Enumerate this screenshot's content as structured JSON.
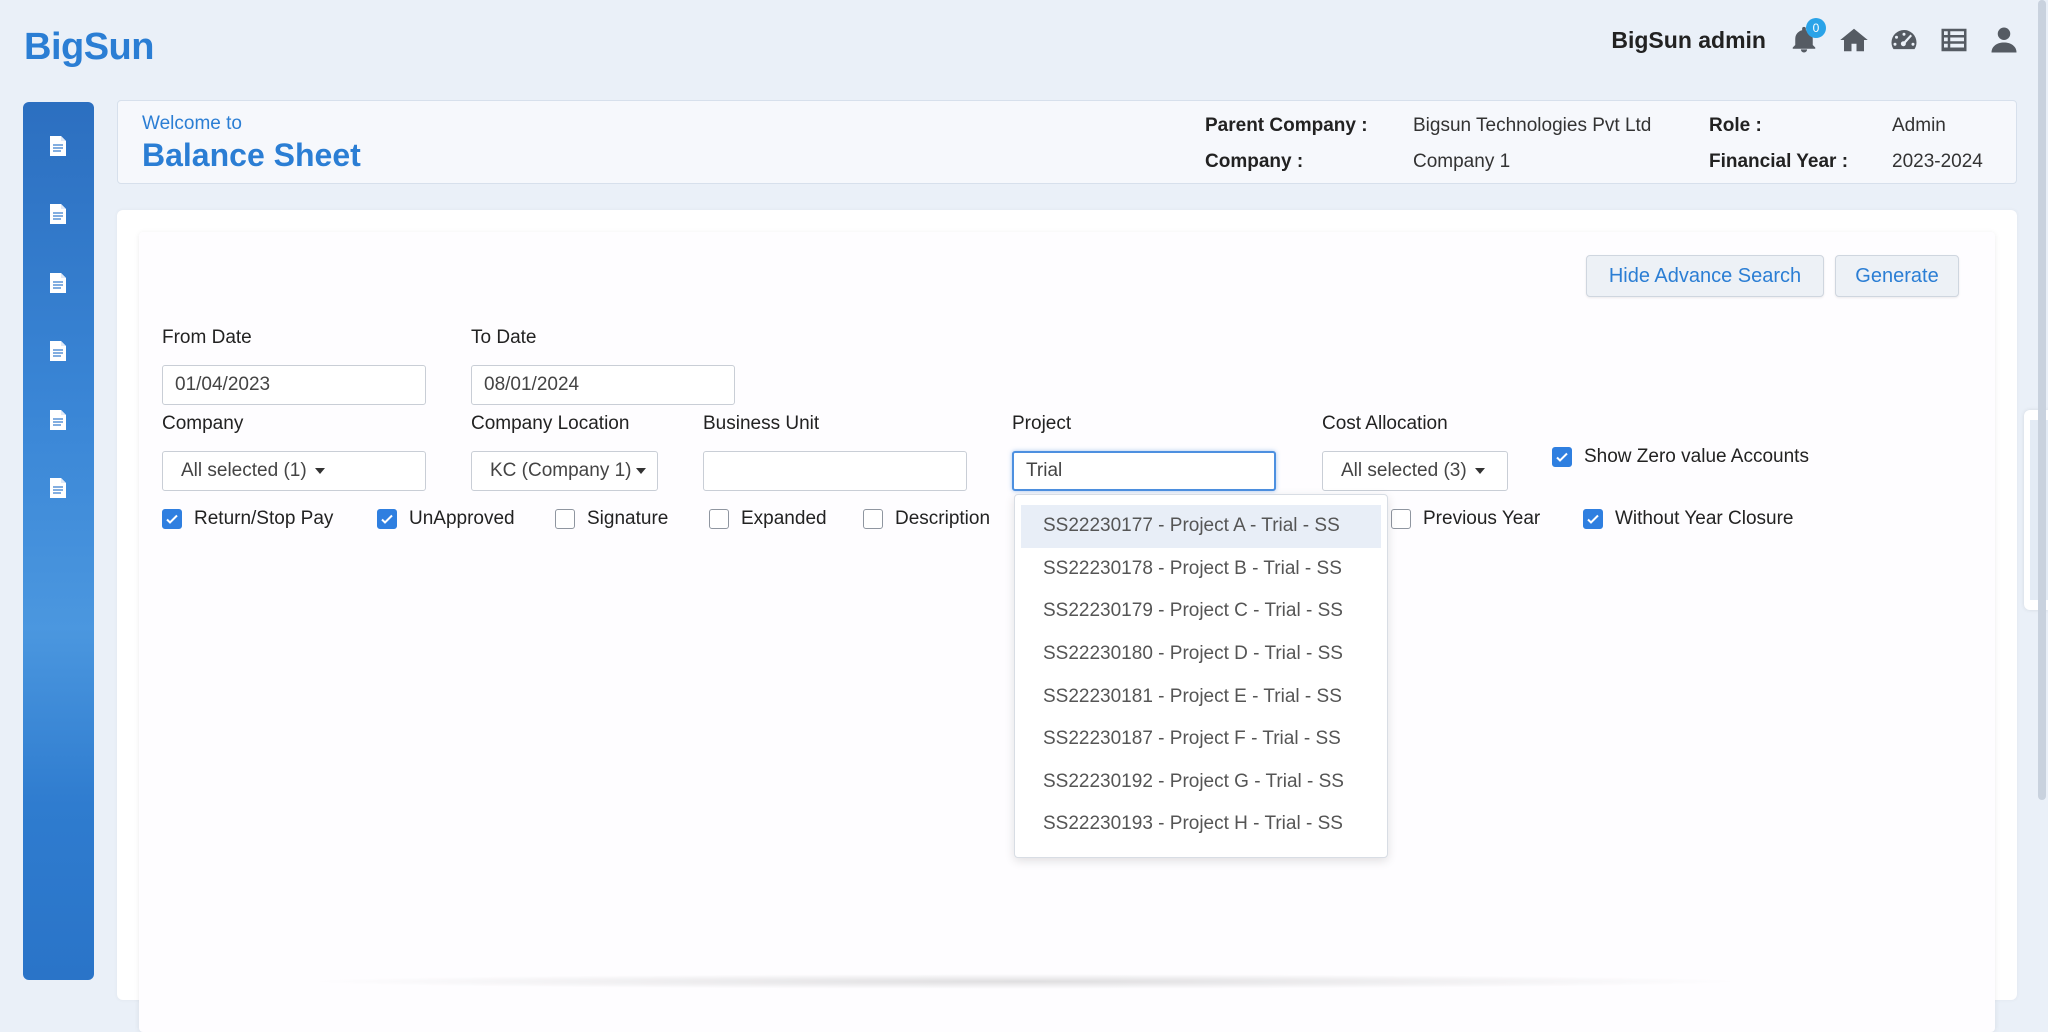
{
  "app": {
    "logo": "BigSun"
  },
  "topbar": {
    "user_name": "BigSun admin",
    "notification_count": "0",
    "icons": [
      "bell-icon",
      "home-icon",
      "dashboard-icon",
      "list-icon",
      "user-icon"
    ]
  },
  "sidebar": {
    "items": [
      "document-icon",
      "document-icon",
      "document-icon",
      "document-icon",
      "document-icon",
      "document-icon"
    ]
  },
  "header": {
    "welcome": "Welcome to",
    "title": "Balance Sheet",
    "parent_company_label": "Parent Company :",
    "parent_company_value": "Bigsun Technologies Pvt Ltd",
    "company_label": "Company :",
    "company_value": "Company 1",
    "role_label": "Role :",
    "role_value": "Admin",
    "fy_label": "Financial Year :",
    "fy_value": "2023-2024"
  },
  "actions": {
    "hide_advance": "Hide Advance Search",
    "generate": "Generate"
  },
  "filters": {
    "from_date_label": "From Date",
    "from_date_value": "01/04/2023",
    "to_date_label": "To Date",
    "to_date_value": "08/01/2024",
    "company_label": "Company",
    "company_value": "All selected (1)",
    "company_location_label": "Company Location",
    "company_location_value": "KC (Company 1)",
    "business_unit_label": "Business Unit",
    "business_unit_value": "",
    "project_label": "Project",
    "project_value": "Trial",
    "cost_allocation_label": "Cost Allocation",
    "cost_allocation_value": "All selected (3)",
    "show_zero_label": "Show Zero value Accounts"
  },
  "checkboxes": {
    "return_stop_pay": "Return/Stop Pay",
    "unapproved": "UnApproved",
    "signature": "Signature",
    "expanded": "Expanded",
    "description": "Description",
    "previous_year": "Previous Year",
    "without_year_closure": "Without Year Closure"
  },
  "project_dropdown": {
    "items": [
      "SS22230177 - Project A - Trial - SS",
      "SS22230178 - Project B - Trial - SS",
      "SS22230179 - Project C - Trial - SS",
      "SS22230180 - Project D - Trial - SS",
      "SS22230181 - Project E - Trial - SS",
      "SS22230187 - Project F - Trial - SS",
      "SS22230192 - Project G - Trial - SS",
      "SS22230193 - Project H - Trial - SS"
    ]
  },
  "colors": {
    "accent": "#2b7ed4",
    "checkbox": "#2f7fe0",
    "badge": "#2aa3e8"
  }
}
